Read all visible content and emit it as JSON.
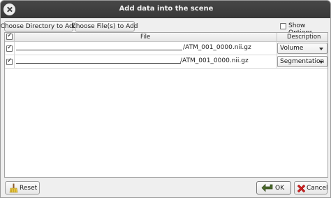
{
  "window": {
    "title": "Add data into the scene"
  },
  "toolbar": {
    "choose_directory_label": "Choose Directory to Add",
    "choose_files_label": "Choose File(s) to Add",
    "show_options_label": "Show Options",
    "show_options_checked": false
  },
  "table": {
    "columns": {
      "file": "File",
      "description": "Description"
    },
    "rows": [
      {
        "checked": true,
        "file_name": "/ATM_001_0000.nii.gz",
        "description": "Volume"
      },
      {
        "checked": true,
        "file_name": "/ATM_001_0000.nii.gz",
        "description": "Segmentation"
      }
    ]
  },
  "footer": {
    "reset_label": "Reset",
    "ok_label": "OK",
    "cancel_label": "Cancel"
  },
  "icons": {
    "reset": "broom-icon",
    "ok": "ok-arrow-icon",
    "cancel": "red-x-icon"
  },
  "colors": {
    "title_bar": "#3c3c3c",
    "cancel_x": "#cc2222",
    "ok_arrow": "#4b6a2c"
  }
}
